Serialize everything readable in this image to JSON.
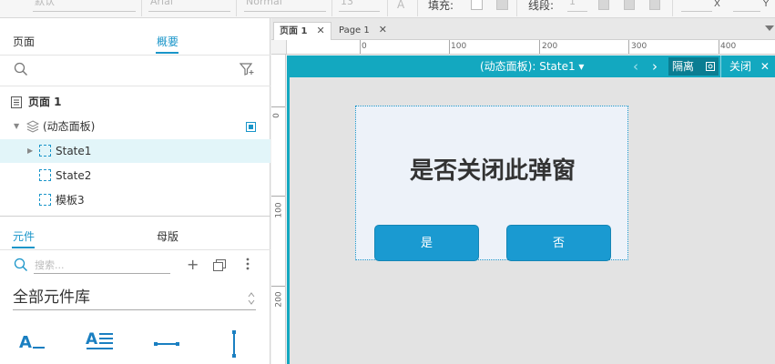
{
  "toolbar": {
    "font_style": "默认",
    "font_family": "Arial",
    "font_weight": "Normal",
    "font_size": "13",
    "fill_label": "填充:",
    "line_label": "线段:",
    "line_value": "1",
    "x_label": "X",
    "y_label": "Y",
    "font_icon": "A"
  },
  "outline_panel": {
    "tab_pages": "页面",
    "tab_outline": "概要",
    "tree": [
      {
        "label": "页面 1",
        "type": "page"
      },
      {
        "label": "(动态面板)",
        "type": "dynamic-panel"
      },
      {
        "label": "State1",
        "type": "state",
        "selected": true
      },
      {
        "label": "State2",
        "type": "state"
      },
      {
        "label": "模板3",
        "type": "state"
      }
    ]
  },
  "library_panel": {
    "tab_widgets": "元件",
    "tab_masters": "母版",
    "search_placeholder": "搜索...",
    "library_name": "全部元件库"
  },
  "page_tabs": [
    {
      "label": "页面 1",
      "active": true
    },
    {
      "label": "Page 1",
      "active": false
    }
  ],
  "ruler": {
    "h_labels": [
      "0",
      "100",
      "200",
      "300",
      "400"
    ],
    "v_labels": [
      "0",
      "100",
      "200"
    ]
  },
  "dynamic_panel": {
    "title": "(动态面板): State1 ▾",
    "prev": "‹",
    "next": "›",
    "hide_label": "隔离",
    "close_label": "关闭"
  },
  "popup": {
    "title": "是否关闭此弹窗",
    "yes": "是",
    "no": "否"
  },
  "colors": {
    "accent": "#1995c9",
    "panel_bar": "#13a8c0",
    "button": "#1a9ad1"
  }
}
